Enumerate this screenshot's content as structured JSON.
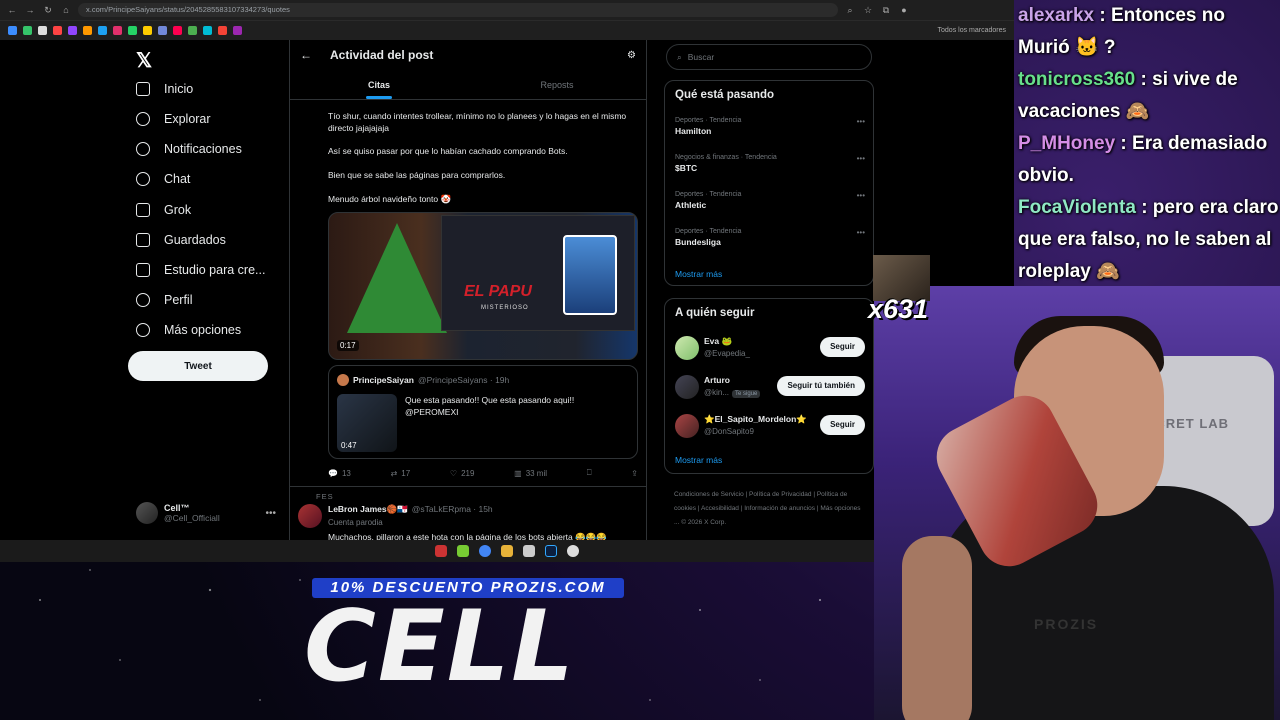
{
  "browser": {
    "url": "x.com/PrincipeSaiyans/status/2045285583107334273/quotes",
    "bookmarks_label": "Todos los marcadores"
  },
  "nav": {
    "items": [
      {
        "label": "Inicio",
        "icon": "home-icon"
      },
      {
        "label": "Explorar",
        "icon": "search-icon"
      },
      {
        "label": "Notificaciones",
        "icon": "bell-icon"
      },
      {
        "label": "Chat",
        "icon": "chat-icon"
      },
      {
        "label": "Grok",
        "icon": "grok-icon"
      },
      {
        "label": "Guardados",
        "icon": "bookmark-icon"
      },
      {
        "label": "Estudio para cre...",
        "icon": "rocket-icon"
      },
      {
        "label": "Perfil",
        "icon": "profile-icon"
      },
      {
        "label": "Más opciones",
        "icon": "more-icon"
      }
    ],
    "tweet_button": "Tweet",
    "account": {
      "name": "Cell™",
      "handle": "@Cell_Officiall"
    }
  },
  "center": {
    "title": "Actividad del post",
    "tabs": [
      "Citas",
      "Reposts"
    ],
    "post": {
      "lines": [
        "Tío shur, cuando intentes trollear, mínimo no lo planees y lo hagas en el mismo directo jajajajaja",
        "Así se quiso pasar por que lo habían cachado comprando Bots.",
        "Bien que se sabe las páginas para comprarlos.",
        "Menudo árbol navideño tonto 🤡"
      ],
      "media": {
        "overlay_text": "EL PAPU",
        "subtitle": "MISTERIOSO",
        "duration": "0:17"
      },
      "quoted": {
        "name": "PrincipeSaiyan",
        "handle": "@PrincipeSaiyans · 19h",
        "text": "Que esta pasando!! Que esta pasando aqui!! @PEROMEXI",
        "video_duration": "0:47"
      },
      "stats": {
        "replies": "13",
        "reposts": "17",
        "likes": "219",
        "views": "33 mil"
      }
    },
    "reply": {
      "context": "FES",
      "name": "LeBron James🏀🇵🇦",
      "handle": "@sTaLkERpma · 15h",
      "badge": "Cuenta parodia",
      "text": "Muchachos, pillaron a este hota con la página de los bots abierta 😂😂😂"
    }
  },
  "right": {
    "search_placeholder": "Buscar",
    "trends_title": "Qué está pasando",
    "trends": [
      {
        "category": "Deportes · Tendencia",
        "name": "Hamilton"
      },
      {
        "category": "Negocios & finanzas · Tendencia",
        "name": "$BTC"
      },
      {
        "category": "Deportes · Tendencia",
        "name": "Athletic"
      },
      {
        "category": "Deportes · Tendencia",
        "name": "Bundesliga"
      }
    ],
    "show_more": "Mostrar más",
    "follow_title": "A quién seguir",
    "follow": [
      {
        "name": "Eva 🐸",
        "handle": "@Evapedia_",
        "button": "Seguir",
        "badge": ""
      },
      {
        "name": "Arturo",
        "handle": "@kin...",
        "button": "Seguir tú también",
        "badge": "Te sigue"
      },
      {
        "name": "⭐El_Sapito_Mordelon⭐",
        "handle": "@DonSapito9",
        "button": "Seguir",
        "badge": ""
      }
    ],
    "footer": "Condiciones de Servicio | Política de Privacidad | Política de cookies | Accesibilidad | Información de anuncios | Más opciones ... © 2026 X Corp."
  },
  "stream_chat": [
    {
      "user": "alexarkx",
      "text": ": Entonces no Murió 🐱 ?"
    },
    {
      "user": "tonicross360",
      "text": ": si vive de vacaciones 🙈"
    },
    {
      "user": "P_MHoney",
      "text": ": Era demasiado obvio."
    },
    {
      "user": "FocaViolenta",
      "text": ": pero era claro que era falso, no le saben al roleplay 🙈"
    }
  ],
  "overlay": {
    "combo": "x631",
    "promo": "10% DESCUENTO PROZIS.COM",
    "brand": "CELL",
    "chair_logo": "SECRET LAB",
    "shirt_text": "PROZIS"
  }
}
